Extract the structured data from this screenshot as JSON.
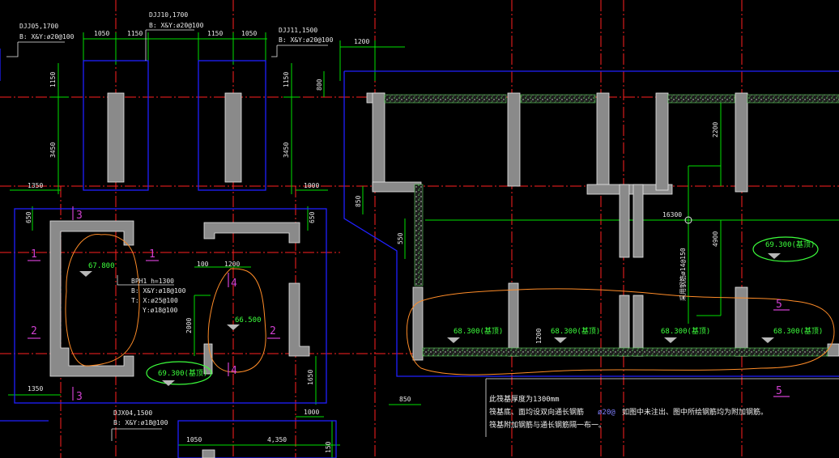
{
  "colors": {
    "background": "#000000",
    "axis": "#ff2020",
    "dimension": "#00ff00",
    "outline": "#2020ff",
    "wall": "#8a8a8a",
    "hatch": "#2a9a2a",
    "cloud": "#ff8c28",
    "section": "#d040d0",
    "text": "#f0f0f0"
  },
  "pile_caps": {
    "djj05": {
      "name": "DJJ05,1700",
      "rebar": "B: X&Y:ø20@100"
    },
    "djj10": {
      "name": "DJJ10,1700",
      "rebar": "B: X&Y:ø20@100"
    },
    "djj11": {
      "name": "DJJ11,1500",
      "rebar": "B: X&Y:ø20@100"
    },
    "djx04": {
      "name": "DJX04,1500",
      "rebar": "B: X&Y:ø18@100"
    },
    "bph1": {
      "name": "BPH1 h=1300",
      "rebar_b": "B: X&Y:ø18@100",
      "rebar_t1": "T: X:ø25@100",
      "rebar_t2": "Y:ø18@100"
    }
  },
  "dimensions": {
    "d1050a": "1050",
    "d1150a": "1150",
    "d1150b": "1150",
    "d1050b": "1050",
    "d1200top": "1200",
    "d1150left": "1150",
    "d3450left": "3450",
    "d1150right": "1150",
    "d3450right": "3450",
    "d800": "800",
    "d1350top": "1350",
    "d1000top": "1000",
    "d650l": "650",
    "d650r": "650",
    "d850v": "850",
    "d550": "550",
    "d100": "100",
    "d1200mid": "1200",
    "d2000": "2000",
    "d1350bot": "1350",
    "d1650": "1650",
    "d1000bot": "1000",
    "d850bot": "850",
    "d1050bot": "1050",
    "d4350": "4,350",
    "d150": "150",
    "d2200": "2200",
    "d16300": "16300",
    "d4900": "4900",
    "d1200v": "1200",
    "rebar_vertical": "采用钢筋ø14@150"
  },
  "elevations": {
    "e67800": "67.800",
    "e66500": "66.500",
    "e69300a": "69.300(基顶)",
    "e69300b": "69.300(基顶)",
    "e68300_1": "68.300(基顶)",
    "e68300_2": "68.300(基顶)",
    "e68300_3": "68.300(基顶)",
    "e68300_4": "68.300(基顶)"
  },
  "sections": {
    "s1a": "1",
    "s1b": "1",
    "s2a": "2",
    "s2b": "2",
    "s3a": "3",
    "s3b": "3",
    "s4a": "4",
    "s4b": "4",
    "s5a": "5",
    "s5b": "5"
  },
  "notes": {
    "line1": "此筏基厚度为1300mm",
    "line2a": "筏基底、面均设双向通长钢筋",
    "line2b": "ø20@",
    "line2c": "如图中未注出、图中所绘钢筋均为附加钢筋。",
    "line3": "筏基附加钢筋与通长钢筋隔一布一。"
  }
}
